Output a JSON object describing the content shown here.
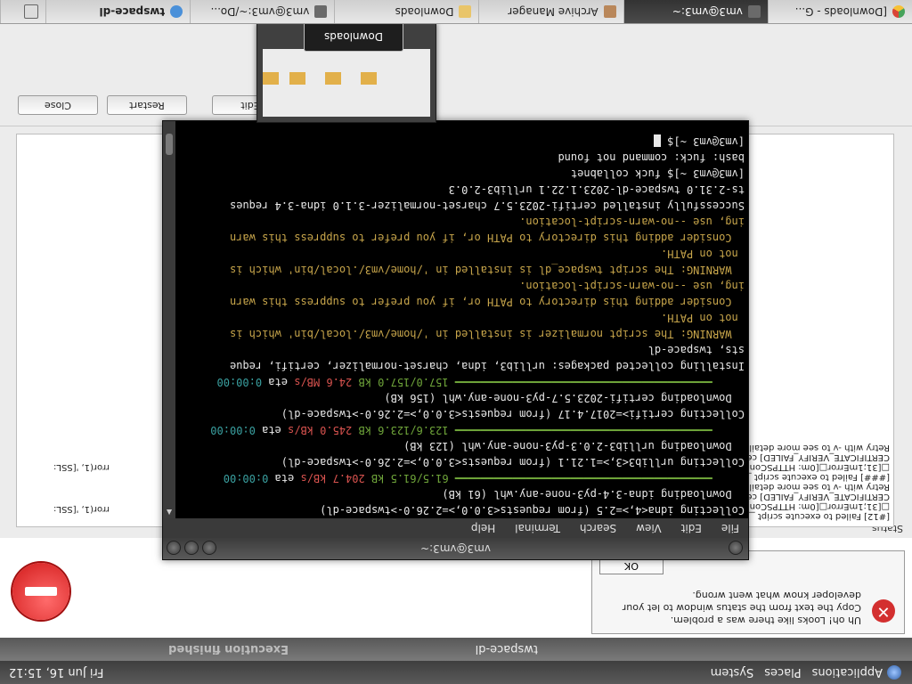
{
  "top_panel": {
    "applications": "Applications",
    "places": "Places",
    "system": "System",
    "clock": "Fri Jun 16, 15:12"
  },
  "taskbar": {
    "tasks": [
      {
        "label": "[Downloads - G...",
        "icon": "chrome-icon"
      },
      {
        "label": "vm3@vm3:~",
        "icon": "terminal-icon"
      },
      {
        "label": "Archive Manager",
        "icon": "archive-icon"
      },
      {
        "label": "Downloads",
        "icon": "folder-icon"
      },
      {
        "label": "vm3@vm3:~/Do...",
        "icon": "terminal-icon"
      },
      {
        "label": "twspace-dl",
        "icon": "app-icon"
      }
    ]
  },
  "exec_window": {
    "title": "Execution finished",
    "app": "twspace-dl",
    "error": {
      "line1": "Uh oh! Looks like there was a problem.",
      "line2": "Copy the text from the status window to let your",
      "line3": "developer know what went wrong.",
      "ok": "OK"
    },
    "status_label": "Status",
    "log_a": [
      "[#12] Failed to execute script __m",
      "□[31;1mError□[0m: HTTPSConn",
      "CERTIFICATE_VERIFY_FAILED] certi",
      "Retry with -v to see more details",
      "[###] Failed to execute script __m",
      "□[31;1mError□[0m: HTTPSConn",
      "CERTIFICATE_VERIFY_FAILED] certi",
      "Retry with -v to see more details"
    ],
    "log_c": [
      "rror(1, '[SSL:",
      "rror(1, '[SSL:"
    ],
    "buttons": {
      "close": "Close",
      "restart": "Restart",
      "edit": "Edit"
    }
  },
  "terminal": {
    "title": "vm3@vm3:~",
    "menu": [
      "File",
      "Edit",
      "View",
      "Search",
      "Terminal",
      "Help"
    ],
    "lines": {
      "l1": "Collecting idna<4,>=2.5 (from requests<3.0.0,>=2.26.0->twspace-dl)",
      "l2": "  Downloading idna-3.4-py3-none-any.whl (61 kB)",
      "l3_bar": "     ━━━━━━━━━━━━━━━━━━━━━━━━━━━━━━━━━━━━━━━━ ",
      "l3_size": "61.5/61.5 kB",
      "l3_speed": "204.7 kB/s",
      "l3_eta_label": " eta ",
      "l3_eta": "0:00:00",
      "l4": "Collecting urllib3<3,>=1.21.1 (from requests<3.0.0,>=2.26.0->twspace-dl)",
      "l5": "  Downloading urllib3-2.0.3-py3-none-any.whl (123 kB)",
      "l6_size": "123.6/123.6 kB",
      "l6_speed": "245.0 kB/s",
      "l6_eta": "0:00:00",
      "l7": "Collecting certifi>=2017.4.17 (from requests<3.0.0,>=2.26.0->twspace-dl)",
      "l8": "  Downloading certifi-2023.5.7-py3-none-any.whl (156 kB)",
      "l9_size": "157.0/157.0 kB",
      "l9_speed": "24.6 MB/s",
      "l9_eta": "0:00:00",
      "l10": "Installing collected packages: urllib3, idna, charset-normalizer, certifi, reque",
      "l11": "sts, twspace-dl",
      "l12": "  WARNING: The script normalizer is installed in '/home/vm3/.local/bin' which is",
      "l13": " not on PATH.",
      "l14": "  Consider adding this directory to PATH or, if you prefer to suppress this warn",
      "l15": "ing, use --no-warn-script-location.",
      "l16": "  WARNING: The script twspace_dl is installed in '/home/vm3/.local/bin' which is",
      "l17": " not on PATH.",
      "l18": "  Consider adding this directory to PATH or, if you prefer to suppress this warn",
      "l19": "ing, use --no-warn-script-location.",
      "l20": "Successfully installed certifi-2023.5.7 charset-normalizer-3.1.0 idna-3.4 reques",
      "l21": "ts-2.31.0 twspace-dl-2023.1.22.1 urllib3-2.0.3",
      "l22": "[vm3@vm3 ~]$ fuck collabnet",
      "l23": "bash: fuck: command not found",
      "l24": "[vm3@vm3 ~]$ "
    }
  },
  "preview": {
    "label": "Downloads"
  },
  "colors": {
    "warning": "#c8a64b",
    "progress": "#6fa53a",
    "speed": "#d9534f",
    "eta": "#3aa0a0"
  }
}
